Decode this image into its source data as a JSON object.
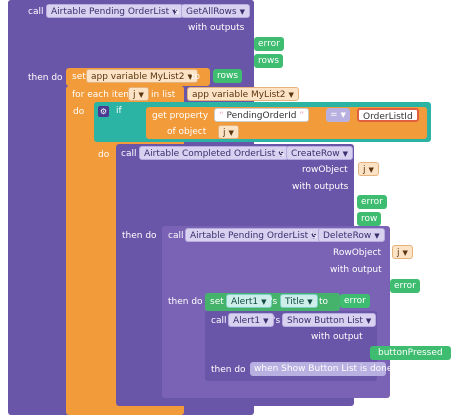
{
  "blocks": {
    "getall": {
      "call": "call",
      "component": "Airtable Pending OrderList",
      "s": "'s",
      "method": "GetAllRows",
      "with_outputs": "with outputs",
      "out1": "error",
      "out2": "rows",
      "then_do": "then do"
    },
    "set": {
      "set": "set",
      "var": "app variable MyList2",
      "to": "to",
      "value": "rows"
    },
    "foreach": {
      "label": "for each item",
      "item": "j",
      "in_list": "in list",
      "list": "app variable MyList2",
      "do": "do"
    },
    "if": {
      "if": "if",
      "get_property": "get property",
      "prop": "PendingOrderId",
      "eq": "=",
      "rhs": "OrderListId",
      "of_object": "of object",
      "obj": "j"
    },
    "createrow": {
      "do": "do",
      "call": "call",
      "component": "Airtable Completed OrderList",
      "s": "'s",
      "method": "CreateRow",
      "rowobject_label": "rowObject",
      "rowobject": "j",
      "with_outputs": "with outputs",
      "out1": "error",
      "out2": "row",
      "then_do": "then do"
    },
    "deleterow": {
      "call": "call",
      "component": "Airtable Pending OrderList",
      "s": "'s",
      "method": "DeleteRow",
      "rowobject_label": "RowObject",
      "rowobject": "j",
      "with_output": "with output",
      "out1": "error",
      "then_do": "then do"
    },
    "settitle": {
      "set": "set",
      "component": "Alert1",
      "s": "'s",
      "prop": "Title",
      "to": "to",
      "value": "error"
    },
    "showbutton": {
      "call": "call",
      "component": "Alert1",
      "s": "'s",
      "method": "Show Button List",
      "with_output": "with output",
      "out1": "buttonPressed",
      "then_do": "then do",
      "event": "when Show Button List is done"
    }
  },
  "icons": {
    "dropdown": "triangle-down-icon",
    "gear": "gear-icon"
  },
  "colors": {
    "purple": "#6a56a8",
    "orange": "#f29b3b",
    "teal": "#2bb3a4",
    "red": "#e06040",
    "green": "#3ebd71"
  }
}
